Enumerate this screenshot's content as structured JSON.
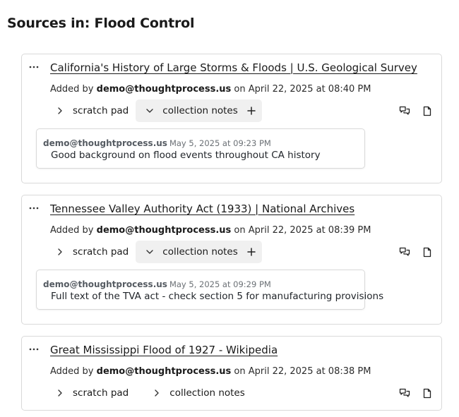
{
  "page": {
    "title": "Sources in: Flood Control"
  },
  "labels": {
    "added_by": "Added by",
    "on": "on",
    "scratch_pad": "scratch pad",
    "collection_notes": "collection notes"
  },
  "icons": {
    "more": "more-horizontal-icon",
    "chevron_right": "chevron-right-icon",
    "chevron_down": "chevron-down-icon",
    "plus": "plus-icon",
    "chat": "chat-bubbles-icon",
    "document": "document-icon"
  },
  "sources": [
    {
      "title": "California's History of Large Storms & Floods | U.S. Geological Survey",
      "added_by": "demo@thoughtprocess.us",
      "added_on": "April 22, 2025 at 08:40 PM",
      "scratch_pad_open": false,
      "collection_notes_open": true,
      "note": {
        "author": "demo@thoughtprocess.us",
        "date": "May 5, 2025 at 09:23 PM",
        "text": "Good background on flood events throughout CA history"
      }
    },
    {
      "title": "Tennessee Valley Authority Act (1933) | National Archives",
      "added_by": "demo@thoughtprocess.us",
      "added_on": "April 22, 2025 at 08:39 PM",
      "scratch_pad_open": false,
      "collection_notes_open": true,
      "note": {
        "author": "demo@thoughtprocess.us",
        "date": "May 5, 2025 at 09:29 PM",
        "text": "Full text of the TVA act - check section 5 for manufacturing provisions"
      }
    },
    {
      "title": "Great Mississippi Flood of 1927 - Wikipedia",
      "added_by": "demo@thoughtprocess.us",
      "added_on": "April 22, 2025 at 08:38 PM",
      "scratch_pad_open": false,
      "collection_notes_open": false
    }
  ]
}
